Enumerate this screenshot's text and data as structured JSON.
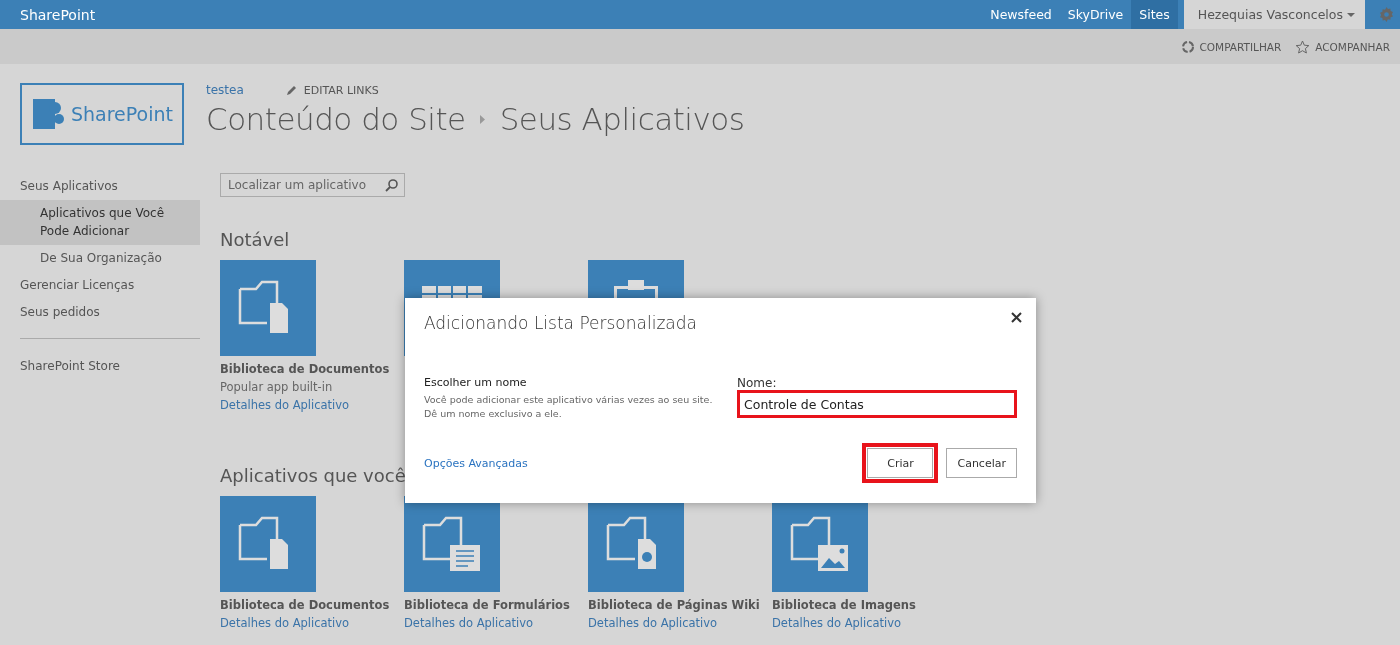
{
  "suite_bar": {
    "brand": "SharePoint",
    "links": [
      {
        "label": "Newsfeed",
        "selected": false
      },
      {
        "label": "SkyDrive",
        "selected": false
      },
      {
        "label": "Sites",
        "selected": true
      }
    ],
    "user": "Hezequias Vasconcelos"
  },
  "actions": [
    "COMPARTILHAR",
    "ACOMPANHAR"
  ],
  "logo": {
    "text": "SharePoint"
  },
  "top_links": {
    "site": "testea",
    "edit": "EDITAR LINKS"
  },
  "breadcrumb": [
    "Conteúdo do Site",
    "Seus Aplicativos"
  ],
  "sidebar": {
    "items": [
      {
        "label": "Seus Aplicativos",
        "selected": false,
        "children": [
          {
            "label": "Aplicativos que Você Pode Adicionar",
            "selected": true
          },
          {
            "label": "De Sua Organização",
            "selected": false
          }
        ]
      },
      {
        "label": "Gerenciar Licenças",
        "selected": false
      },
      {
        "label": "Seus pedidos",
        "selected": false
      }
    ],
    "store": "SharePoint Store"
  },
  "search": {
    "placeholder": "Localizar um aplicativo"
  },
  "notable": {
    "heading": "Notável",
    "apps": [
      {
        "kind": "document",
        "name": "Biblioteca de Documentos",
        "subtitle": "Popular app built-in",
        "link": "Detalhes do Aplicativo"
      },
      {
        "kind": "list"
      },
      {
        "kind": "task"
      }
    ]
  },
  "addable": {
    "heading": "Aplicativos que você",
    "apps": [
      {
        "kind": "document",
        "name": "Biblioteca de Documentos",
        "link": "Detalhes do Aplicativo"
      },
      {
        "kind": "form",
        "name": "Biblioteca de Formulários",
        "link": "Detalhes do Aplicativo"
      },
      {
        "kind": "wiki",
        "name": "Biblioteca de Páginas Wiki",
        "link": "Detalhes do Aplicativo"
      },
      {
        "kind": "image",
        "name": "Biblioteca de Imagens",
        "link": "Detalhes do Aplicativo"
      }
    ]
  },
  "dialog": {
    "title": "Adicionando Lista Personalizada",
    "section_title": "Escolher um nome",
    "section_text": "Você pode adicionar este aplicativo várias vezes ao seu site. Dê um nome exclusivo a ele.",
    "field_label": "Nome:",
    "field_value": "Controle de Contas",
    "field_highlighted": true,
    "advanced_link": "Opções Avançadas",
    "buttons": [
      {
        "label": "Criar",
        "highlighted": true
      },
      {
        "label": "Cancelar",
        "highlighted": false
      }
    ]
  }
}
